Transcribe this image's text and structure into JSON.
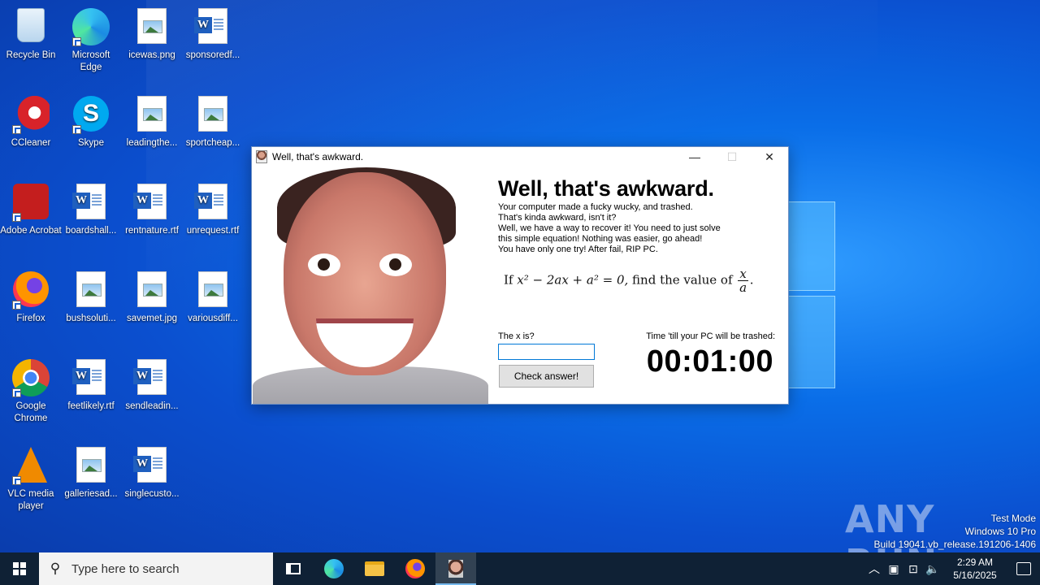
{
  "desktop": {
    "icons": [
      {
        "label": "Recycle Bin",
        "icon": "recycle-bin-icon"
      },
      {
        "label": "Microsoft Edge",
        "icon": "edge-icon"
      },
      {
        "label": "icewas.png",
        "icon": "image-file-icon"
      },
      {
        "label": "sponsoredf...",
        "icon": "word-document-icon"
      },
      {
        "label": "CCleaner",
        "icon": "ccleaner-icon"
      },
      {
        "label": "Skype",
        "icon": "skype-icon"
      },
      {
        "label": "leadingthe...",
        "icon": "image-file-icon"
      },
      {
        "label": "sportcheap...",
        "icon": "image-file-icon"
      },
      {
        "label": "Adobe Acrobat",
        "icon": "acrobat-icon"
      },
      {
        "label": "boardshall...",
        "icon": "word-document-icon"
      },
      {
        "label": "rentnature.rtf",
        "icon": "word-document-icon"
      },
      {
        "label": "unrequest.rtf",
        "icon": "word-document-icon"
      },
      {
        "label": "Firefox",
        "icon": "firefox-icon"
      },
      {
        "label": "bushsoluti...",
        "icon": "image-file-icon"
      },
      {
        "label": "savemet.jpg",
        "icon": "image-file-icon"
      },
      {
        "label": "variousdiff...",
        "icon": "image-file-icon"
      },
      {
        "label": "Google Chrome",
        "icon": "chrome-icon"
      },
      {
        "label": "feetlikely.rtf",
        "icon": "word-document-icon"
      },
      {
        "label": "sendleadin...",
        "icon": "word-document-icon"
      },
      {
        "label": "VLC media player",
        "icon": "vlc-icon"
      },
      {
        "label": "galleriesad...",
        "icon": "image-file-icon"
      },
      {
        "label": "singlecusto...",
        "icon": "word-document-icon"
      }
    ]
  },
  "window": {
    "title": "Well, that's awkward.",
    "minimize_label": "—",
    "maximize_label": "☐",
    "close_label": "✕",
    "heading": "Well, that's awkward.",
    "message_lines": [
      "Your computer made a fucky wucky, and trashed.",
      "That's kinda awkward, isn't it?",
      "Well, we have a way to recover it! You need to just solve",
      "this simple equation! Nothing was easier, go ahead!",
      "You have only one try! After fail, RIP PC."
    ],
    "equation": {
      "prefix": "If",
      "expression": "x² − 2ax + a² = 0,",
      "suffix": "find the value of",
      "fraction_num": "x",
      "fraction_den": "a"
    },
    "answer_label": "The x is?",
    "answer_value": "",
    "check_button": "Check answer!",
    "timer_label": "Time 'till your PC will be trashed:",
    "timer_value": "00:01:00"
  },
  "watermark": {
    "logo_text": "ANY RUN",
    "lines": [
      "Test Mode",
      "Windows 10 Pro",
      "Build 19041.vb_release.191206-1406"
    ]
  },
  "taskbar": {
    "search_placeholder": "Type here to search",
    "time": "2:29 AM",
    "date": "5/16/2025"
  },
  "colors": {
    "wallpaper": "#0b5fd8",
    "taskbar": "#0f2135",
    "input_focus": "#0078d7"
  }
}
